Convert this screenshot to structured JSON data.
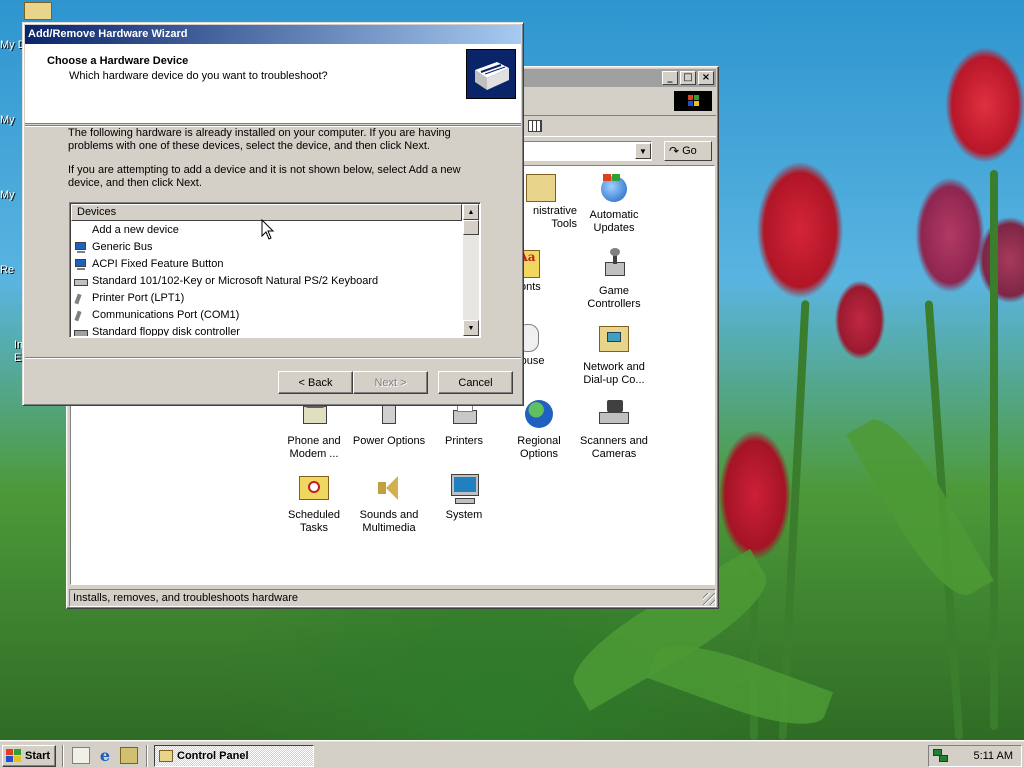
{
  "desktop": {
    "icon_labels": [
      "My D",
      "My",
      "My",
      "Re",
      "In",
      "E"
    ]
  },
  "control_panel": {
    "title": "Control Panel",
    "go_label": "Go",
    "status_text": "Installs, removes, and troubleshoots hardware",
    "items": [
      {
        "label": "Administrative Tools",
        "icon": "admin-tools-icon"
      },
      {
        "label": "Automatic Updates",
        "icon": "windows-update-icon"
      },
      {
        "label": "Fonts",
        "icon": "fonts-icon"
      },
      {
        "label": "Game Controllers",
        "icon": "joystick-icon"
      },
      {
        "label": "Mouse",
        "icon": "mouse-icon"
      },
      {
        "label": "Network and Dial-up Co...",
        "icon": "network-icon"
      },
      {
        "label": "Phone and Modem ...",
        "icon": "phone-icon"
      },
      {
        "label": "Power Options",
        "icon": "power-icon"
      },
      {
        "label": "Printers",
        "icon": "printer-icon"
      },
      {
        "label": "Regional Options",
        "icon": "globe-icon"
      },
      {
        "label": "Scanners and Cameras",
        "icon": "scanner-icon"
      },
      {
        "label": "Scheduled Tasks",
        "icon": "scheduled-tasks-icon"
      },
      {
        "label": "Sounds and Multimedia",
        "icon": "speaker-icon"
      },
      {
        "label": "System",
        "icon": "computer-icon"
      }
    ],
    "visible_labels": {
      "admin": "nistrative\nTools",
      "fonts": "Fonts",
      "mouse": "Mouse"
    }
  },
  "wizard": {
    "title": "Add/Remove Hardware Wizard",
    "header_title": "Choose a Hardware Device",
    "header_subtitle": "Which hardware device do you want to troubleshoot?",
    "paragraph1": "The following hardware is already installed on your computer. If you are having problems with one of these devices, select the device, and then click Next.",
    "paragraph2": "If you are attempting to add a device and it is not shown below, select Add a new device, and then click Next.",
    "list_header": "Devices",
    "devices": [
      {
        "label": "Add a new device",
        "icon": "none"
      },
      {
        "label": "Generic Bus",
        "icon": "monitor-icon"
      },
      {
        "label": "ACPI Fixed Feature Button",
        "icon": "monitor-icon"
      },
      {
        "label": "Standard 101/102-Key or Microsoft Natural PS/2 Keyboard",
        "icon": "keyboard-icon"
      },
      {
        "label": "Printer Port (LPT1)",
        "icon": "port-icon"
      },
      {
        "label": "Communications Port (COM1)",
        "icon": "port-icon"
      },
      {
        "label": "Standard floppy disk controller",
        "icon": "floppy-icon"
      }
    ],
    "back_label": "< Back",
    "next_label": "Next >",
    "cancel_label": "Cancel"
  },
  "taskbar": {
    "start_label": "Start",
    "task_label": "Control Panel",
    "clock": "5:11 AM"
  },
  "colors": {
    "title_active_start": "#0a246a",
    "title_active_end": "#a6caf0",
    "face": "#d4d0c8"
  }
}
